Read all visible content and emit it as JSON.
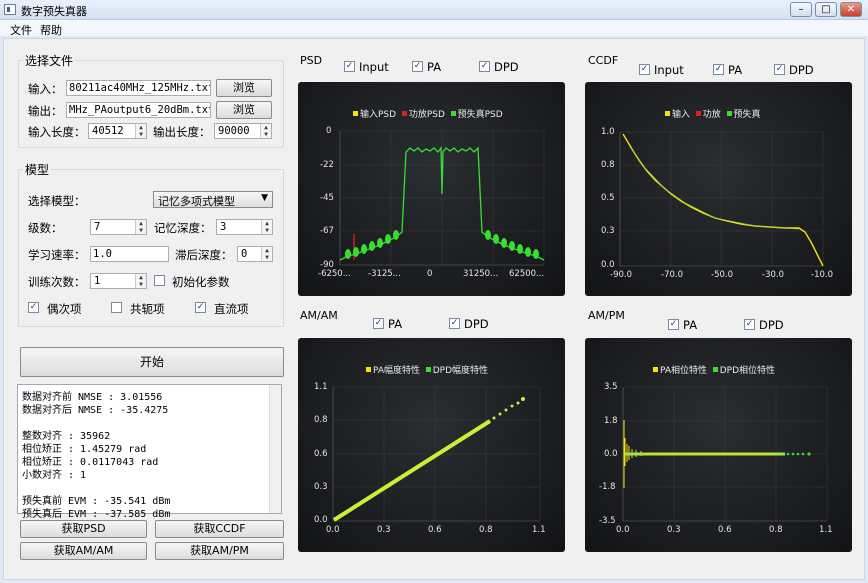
{
  "window": {
    "title": "数字预失真器",
    "min": "–",
    "max": "□",
    "close": "✕"
  },
  "menu": [
    "文件",
    "帮助"
  ],
  "file_group": {
    "title": "选择文件",
    "input_label": "输入：",
    "input_value": "80211ac40MHz_125MHz.txt",
    "output_label": "输出：",
    "output_value": "MHz_PAoutput6_20dBm.txt",
    "browse": "浏览",
    "in_len_label": "输入长度：",
    "in_len": "40512",
    "out_len_label": "输出长度：",
    "out_len": "90000"
  },
  "model_group": {
    "title": "模型",
    "select_label": "选择模型：",
    "model": "记忆多项式模型",
    "order_label": "级数：",
    "order": "7",
    "memory_label": "记忆深度：",
    "memory": "3",
    "lr_label": "学习速率：",
    "lr": "1.0",
    "lag_label": "滞后深度：",
    "lag": "0",
    "train_label": "训练次数：",
    "train": "1",
    "init_label": "初始化参数",
    "even_label": "偶次项",
    "conj_label": "共轭项",
    "dc_label": "直流项"
  },
  "start": "开始",
  "log_lines": [
    "数据对齐前 NMSE : 3.01556",
    "数据对齐后 NMSE : -35.4275",
    "",
    "整数对齐 : 35962",
    "相位矫正 : 1.45279 rad",
    "相位矫正 : 0.0117043 rad",
    "小数对齐 : 1",
    "",
    "预失真前 EVM : -35.541 dBm",
    "预失真后 EVM : -37.585 dBm"
  ],
  "buttons": {
    "psd": "获取PSD",
    "ccdf": "获取CCDF",
    "amam": "获取AM/AM",
    "ampm": "获取AM/PM"
  },
  "colors": {
    "yellow": "#f4e20b",
    "red": "#e02020",
    "green": "#35e030",
    "lightgreen": "#b8f54a"
  },
  "psd": {
    "section": "PSD",
    "cb1": "Input",
    "cb2": "PA",
    "cb3": "DPD",
    "legend": [
      "输入PSD",
      "功放PSD",
      "预失真PSD"
    ],
    "yticks": [
      "0",
      "-22",
      "-45",
      "-67",
      "-90"
    ],
    "xticks": [
      "-6250...",
      "-3125...",
      "0",
      "31250...",
      "62500..."
    ]
  },
  "ccdf": {
    "section": "CCDF",
    "cb1": "Input",
    "cb2": "PA",
    "cb3": "DPD",
    "legend": [
      "输入",
      "功放",
      "预失真"
    ],
    "yticks": [
      "1.0",
      "0.8",
      "0.5",
      "0.3",
      "0.0"
    ],
    "xticks": [
      "-90.0",
      "-70.0",
      "-50.0",
      "-30.0",
      "-10.0"
    ]
  },
  "amam": {
    "section": "AM/AM",
    "cb1": "PA",
    "cb2": "DPD",
    "legend": [
      "PA幅度特性",
      "DPD幅度特性"
    ],
    "yticks": [
      "1.1",
      "0.8",
      "0.6",
      "0.3",
      "0.0"
    ],
    "xticks": [
      "0.0",
      "0.3",
      "0.6",
      "0.8",
      "1.1"
    ]
  },
  "ampm": {
    "section": "AM/PM",
    "cb1": "PA",
    "cb2": "DPD",
    "legend": [
      "PA相位特性",
      "DPD相位特性"
    ],
    "yticks": [
      "3.5",
      "1.8",
      "0.0",
      "-1.8",
      "-3.5"
    ],
    "xticks": [
      "0.0",
      "0.3",
      "0.6",
      "0.8",
      "1.1"
    ]
  }
}
